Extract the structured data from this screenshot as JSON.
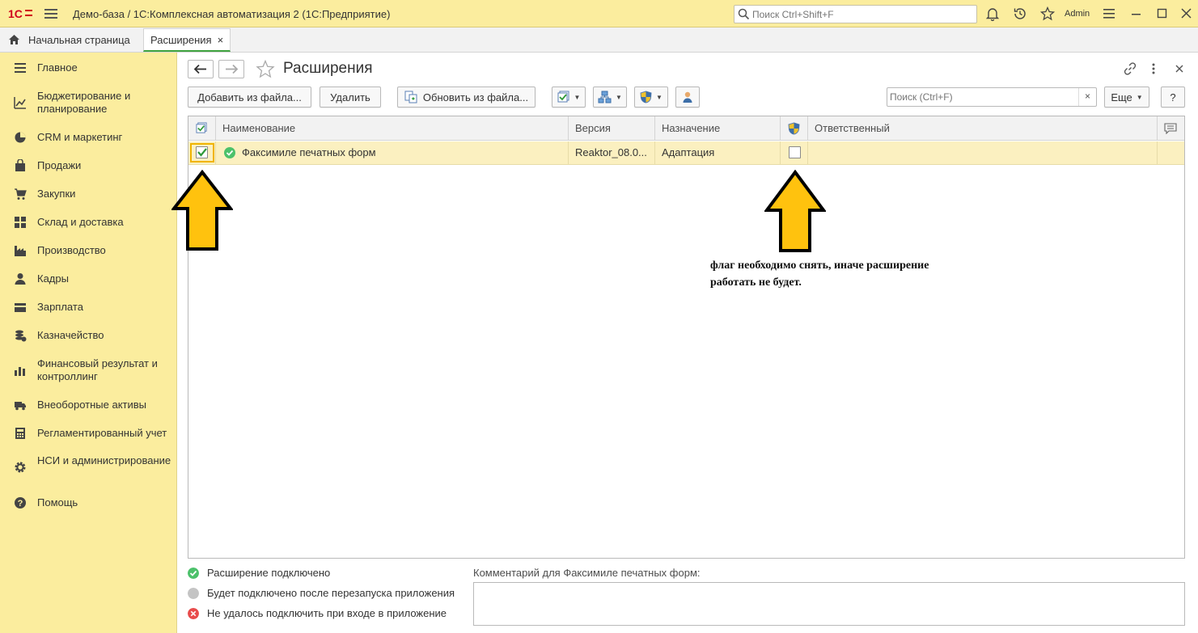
{
  "titlebar": {
    "title": "Демо-база / 1С:Комплексная автоматизация 2  (1С:Предприятие)",
    "search_placeholder": "Поиск Ctrl+Shift+F",
    "user": "Admin",
    "logo_text": "1С"
  },
  "tabs": [
    {
      "label": "Начальная страница"
    },
    {
      "label": "Расширения",
      "close": "×"
    }
  ],
  "sidebar": {
    "items": [
      {
        "label": "Главное",
        "icon": "menu-icon"
      },
      {
        "label": "Бюджетирование и планирование",
        "icon": "chart-icon"
      },
      {
        "label": "CRM и маркетинг",
        "icon": "pie-icon"
      },
      {
        "label": "Продажи",
        "icon": "bag-icon"
      },
      {
        "label": "Закупки",
        "icon": "cart-icon"
      },
      {
        "label": "Склад и доставка",
        "icon": "grid-icon"
      },
      {
        "label": "Производство",
        "icon": "factory-icon"
      },
      {
        "label": "Кадры",
        "icon": "person-icon"
      },
      {
        "label": "Зарплата",
        "icon": "wallet-icon"
      },
      {
        "label": "Казначейство",
        "icon": "coins-icon"
      },
      {
        "label": "Финансовый результат и контроллинг",
        "icon": "bar-chart-icon"
      },
      {
        "label": "Внеоборотные активы",
        "icon": "truck-icon"
      },
      {
        "label": "Регламентированный учет",
        "icon": "calculator-icon"
      },
      {
        "label": "НСИ и администрирование",
        "icon": "gear-icon"
      },
      {
        "label": "Помощь",
        "icon": "help-icon"
      }
    ]
  },
  "page": {
    "title": "Расширения"
  },
  "toolbar": {
    "add_from_file": "Добавить из файла...",
    "delete": "Удалить",
    "update_from_file": "Обновить из файла...",
    "search_placeholder": "Поиск (Ctrl+F)",
    "search_clear": "×",
    "more": "Еще",
    "help": "?"
  },
  "table": {
    "columns": [
      "Наименование",
      "Версия",
      "Назначение",
      "Ответственный"
    ],
    "rows": [
      {
        "active": true,
        "name": "Факсимиле печатных форм",
        "version": "Reaktor_08.0...",
        "purpose": "Адаптация",
        "safe_mode": false,
        "responsible": ""
      }
    ]
  },
  "legend": {
    "connected": "Расширение подключено",
    "after_restart": "Будет подключено после перезапуска приложения",
    "failed": "Не удалось подключить при входе в приложение"
  },
  "comment": {
    "label": "Комментарий для Факсимиле печатных форм:",
    "value": ""
  },
  "annotation": {
    "text": "флаг необходимо снять, иначе расширение работать не будет."
  },
  "colors": {
    "accent_yellow": "#fbed9e",
    "arrow_fill": "#ffc20e",
    "ok_green": "#4cc16b",
    "error_red": "#e84c4c",
    "tab_underline": "#3fa33f"
  }
}
